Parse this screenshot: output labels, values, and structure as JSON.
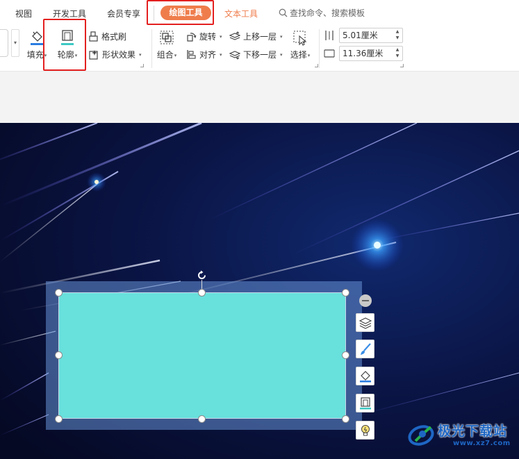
{
  "menu": {
    "tabs": [
      {
        "label": "视图"
      },
      {
        "label": "开发工具"
      },
      {
        "label": "会员专享"
      },
      {
        "label": "绘图工具"
      },
      {
        "label": "文本工具"
      }
    ],
    "active_tab": "绘图工具",
    "search_label": "查找命令、搜索模板"
  },
  "ribbon": {
    "fill_label": "填充",
    "outline_label": "轮廓",
    "format_painter_label": "格式刷",
    "shape_effects_label": "形状效果",
    "group_label": "组合",
    "rotate_label": "旋转",
    "align_label": "对齐",
    "bring_forward_label": "上移一层",
    "send_backward_label": "下移一层",
    "select_label": "选择",
    "height_value": "5.01厘米",
    "width_value": "11.36厘米"
  },
  "shape": {
    "fill_color": "#68e0dc"
  },
  "colors": {
    "accent": "#ef7d4c",
    "highlight_frame": "#e41f1f",
    "slide_background": "#0b1440"
  },
  "watermark": {
    "title": "极光下载站",
    "url": "www.xz7.com"
  }
}
